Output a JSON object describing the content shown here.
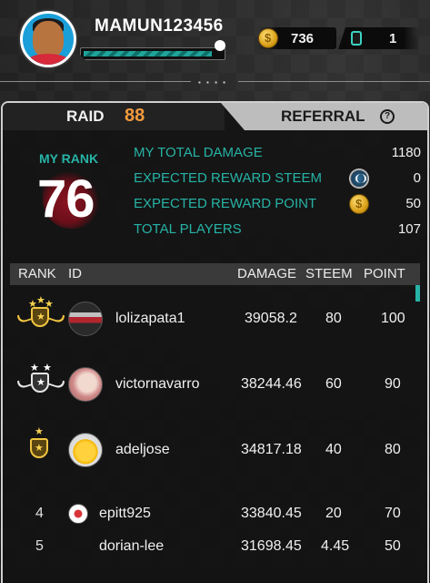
{
  "header": {
    "username": "MAMUN123456",
    "xp_fraction": 0.93,
    "coins": "736",
    "gems": "1"
  },
  "tabs": {
    "raid_label": "RAID",
    "raid_count": "88",
    "referral_label": "REFERRAL",
    "help_icon": "?"
  },
  "my_rank": {
    "label": "MY RANK",
    "value": "76"
  },
  "stats": [
    {
      "label": "MY TOTAL DAMAGE",
      "value": "1180",
      "icon": null
    },
    {
      "label": "EXPECTED REWARD STEEM",
      "value": "0",
      "icon": "steem-icon"
    },
    {
      "label": "EXPECTED REWARD POINT",
      "value": "50",
      "icon": "coin-icon"
    },
    {
      "label": "TOTAL PLAYERS",
      "value": "107",
      "icon": null
    }
  ],
  "table": {
    "headers": {
      "rank": "RANK",
      "id": "ID",
      "damage": "DAMAGE",
      "steem": "STEEM",
      "point": "POINT"
    },
    "rows": [
      {
        "rank": "1",
        "badge": "gold-three-star-winged-badge",
        "id": "lolizapata1",
        "damage": "39058.2",
        "steem": "80",
        "point": "100"
      },
      {
        "rank": "2",
        "badge": "silver-two-star-winged-badge",
        "id": "victornavarro",
        "damage": "38244.46",
        "steem": "60",
        "point": "90"
      },
      {
        "rank": "3",
        "badge": "gold-one-star-badge",
        "id": "adeljose",
        "damage": "34817.18",
        "steem": "40",
        "point": "80"
      },
      {
        "rank": "4",
        "badge": null,
        "id": "epitt925",
        "damage": "33840.45",
        "steem": "20",
        "point": "70"
      },
      {
        "rank": "5",
        "badge": null,
        "id": "dorian-lee",
        "damage": "31698.45",
        "steem": "4.45",
        "point": "50"
      }
    ]
  },
  "colors": {
    "accent_teal": "#27b3a6",
    "raid_count_orange": "#f29a3e",
    "gold": "#f0c541"
  }
}
